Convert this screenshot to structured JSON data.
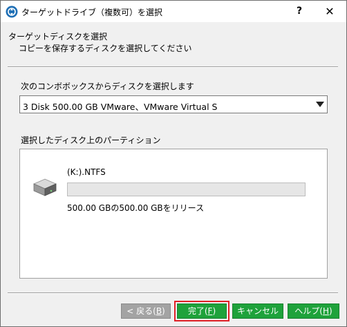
{
  "window": {
    "title": "ターゲットドライブ（複数可）を選択",
    "help_label": "?",
    "close_label": "✕"
  },
  "header": {
    "title": "ターゲットディスクを選択",
    "subtitle": "コピーを保存するディスクを選択してください"
  },
  "combo": {
    "label": "次のコンボボックスからディスクを選択します",
    "selected": "3 Disk 500.00 GB VMware、VMware Virtual S"
  },
  "partitions": {
    "label": "選択したディスク上のパーティション",
    "items": [
      {
        "name": "(K:).NTFS",
        "used_fraction": 0,
        "info": "500.00 GBの500.00 GBをリリース"
      }
    ]
  },
  "buttons": {
    "back": {
      "label": "< 戻る(",
      "key": "B",
      "suffix": ")"
    },
    "finish": {
      "label": "完了(",
      "key": "F",
      "suffix": ")"
    },
    "cancel": {
      "label": "キャンセル"
    },
    "help": {
      "label": "ヘルプ(",
      "key": "H",
      "suffix": ")"
    }
  },
  "colors": {
    "accent_green": "#1ea23b",
    "highlight_red": "#e01f26",
    "disabled_gray": "#a3a3a3"
  }
}
